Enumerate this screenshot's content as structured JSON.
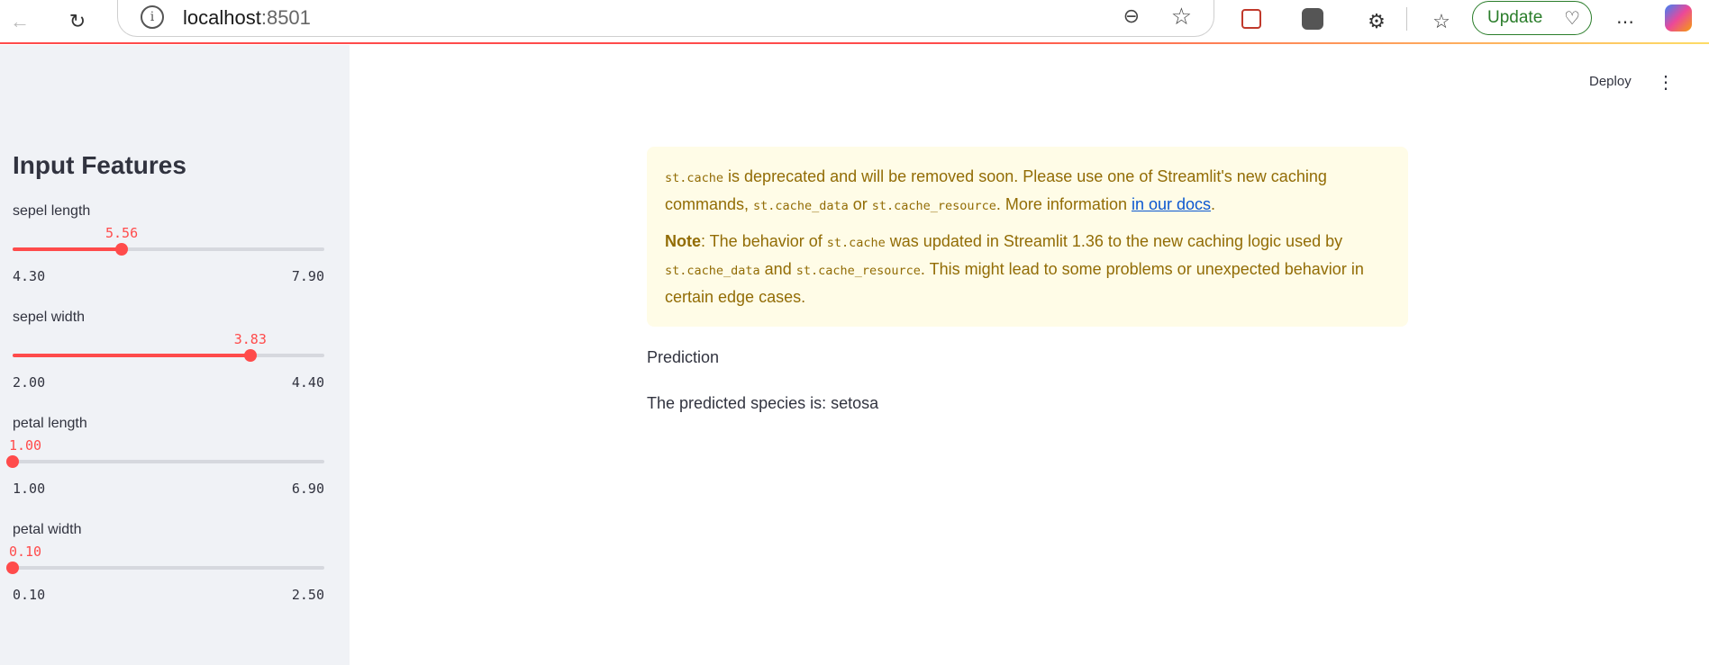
{
  "browser": {
    "url_host": "localhost",
    "url_port": ":8501",
    "update_label": "Update"
  },
  "sidebar": {
    "title": "Input Features",
    "sliders": [
      {
        "label": "sepel length",
        "value": "5.56",
        "min": "4.30",
        "max": "7.90",
        "fraction": 0.3499
      },
      {
        "label": "sepel width",
        "value": "3.83",
        "min": "2.00",
        "max": "4.40",
        "fraction": 0.7625
      },
      {
        "label": "petal length",
        "value": "1.00",
        "min": "1.00",
        "max": "6.90",
        "fraction": 0.0
      },
      {
        "label": "petal width",
        "value": "0.10",
        "min": "0.10",
        "max": "2.50",
        "fraction": 0.0
      }
    ]
  },
  "header": {
    "deploy_label": "Deploy"
  },
  "warning": {
    "p1_code1": "st.cache",
    "p1_text1": " is deprecated and will be removed soon. Please use one of Streamlit's new caching commands, ",
    "p1_code2": "st.cache_data",
    "p1_text2": " or ",
    "p1_code3": "st.cache_resource",
    "p1_text3": ". More information ",
    "p1_link": "in our docs",
    "p1_text4": ".",
    "p2_bold": "Note",
    "p2_text1": ": The behavior of ",
    "p2_code1": "st.cache",
    "p2_text2": " was updated in Streamlit 1.36 to the new caching logic used by ",
    "p2_code2": "st.cache_data",
    "p2_text3": " and ",
    "p2_code3": "st.cache_resource",
    "p2_text4": ". This might lead to some problems or unexpected behavior in certain edge cases."
  },
  "main": {
    "prediction_title": "Prediction",
    "prediction_text": "The predicted species is: setosa"
  },
  "colors": {
    "accent": "#ff4b4b",
    "sidebar_bg": "#f0f2f6",
    "warning_bg": "#fffce7",
    "warning_text": "#926c05"
  }
}
